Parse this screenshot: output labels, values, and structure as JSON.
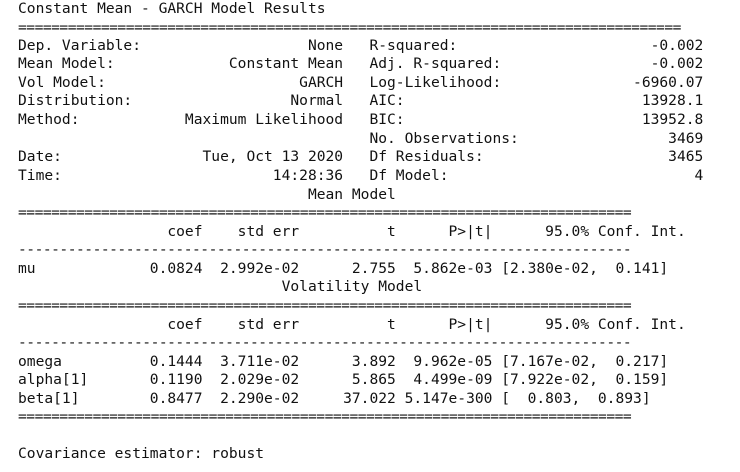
{
  "title": "Constant Mean - GARCH Model Results",
  "rule_double_wide": "================================================================================",
  "rule_double": "==========================================================================",
  "rule_dash": "--------------------------------------------------------------------------",
  "summary_lines": [
    "Dep. Variable:                   None   R-squared:                      -0.002",
    "Mean Model:             Constant Mean   Adj. R-squared:                 -0.002",
    "Vol Model:                      GARCH   Log-Likelihood:               -6960.07",
    "Distribution:                  Normal   AIC:                           13928.1",
    "Method:            Maximum Likelihood   BIC:                           13952.8",
    "                                        No. Observations:                 3469",
    "Date:                Tue, Oct 13 2020   Df Residuals:                     3465",
    "Time:                        14:28:36   Df Model:                            4"
  ],
  "mean_model": {
    "title": "                                 Mean Model",
    "header": "                 coef    std err          t      P>|t|      95.0% Conf. Int.",
    "rows": [
      "mu             0.0824  2.992e-02      2.755  5.862e-03 [2.380e-02,  0.141]"
    ]
  },
  "volatility_model": {
    "title": "                              Volatility Model",
    "header": "                 coef    std err          t      P>|t|      95.0% Conf. Int.",
    "rows": [
      "omega          0.1444  3.711e-02      3.892  9.962e-05 [7.167e-02,  0.217]",
      "alpha[1]       0.1190  2.029e-02      5.865  4.499e-09 [7.922e-02,  0.159]",
      "beta[1]        0.8477  2.290e-02     37.022 5.147e-300 [  0.803,  0.893]"
    ]
  },
  "footer": "Covariance estimator: robust"
}
